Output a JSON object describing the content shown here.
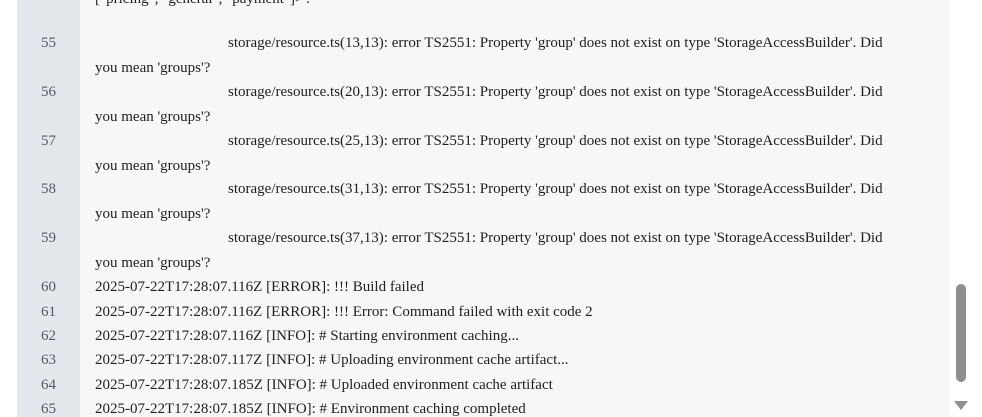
{
  "log": {
    "partial_top": "[\"pricing\", \"general\", \"payment\"]>'.",
    "lines": [
      {
        "num": "55",
        "text": "storage/resource.ts(13,13): error TS2551: Property 'group' does not exist on type 'StorageAccessBuilder'. Did",
        "cont": "you mean 'groups'?"
      },
      {
        "num": "56",
        "text": "storage/resource.ts(20,13): error TS2551: Property 'group' does not exist on type 'StorageAccessBuilder'. Did",
        "cont": "you mean 'groups'?"
      },
      {
        "num": "57",
        "text": "storage/resource.ts(25,13): error TS2551: Property 'group' does not exist on type 'StorageAccessBuilder'. Did",
        "cont": "you mean 'groups'?"
      },
      {
        "num": "58",
        "text": "storage/resource.ts(31,13): error TS2551: Property 'group' does not exist on type 'StorageAccessBuilder'. Did",
        "cont": "you mean 'groups'?"
      },
      {
        "num": "59",
        "text": "storage/resource.ts(37,13): error TS2551: Property 'group' does not exist on type 'StorageAccessBuilder'. Did",
        "cont": "you mean 'groups'?"
      },
      {
        "num": "60",
        "text": "2025-07-22T17:28:07.116Z [ERROR]: !!! Build failed"
      },
      {
        "num": "61",
        "text": "2025-07-22T17:28:07.116Z [ERROR]: !!! Error: Command failed with exit code 2"
      },
      {
        "num": "62",
        "text": "2025-07-22T17:28:07.116Z [INFO]: # Starting environment caching..."
      },
      {
        "num": "63",
        "text": "2025-07-22T17:28:07.117Z [INFO]: # Uploading environment cache artifact..."
      },
      {
        "num": "64",
        "text": "2025-07-22T17:28:07.185Z [INFO]: # Uploaded environment cache artifact"
      },
      {
        "num": "65",
        "text": "2025-07-22T17:28:07.185Z [INFO]: # Environment caching completed"
      }
    ]
  },
  "scrollbar": {
    "down_arrow_icon": "triangle-down-icon"
  }
}
